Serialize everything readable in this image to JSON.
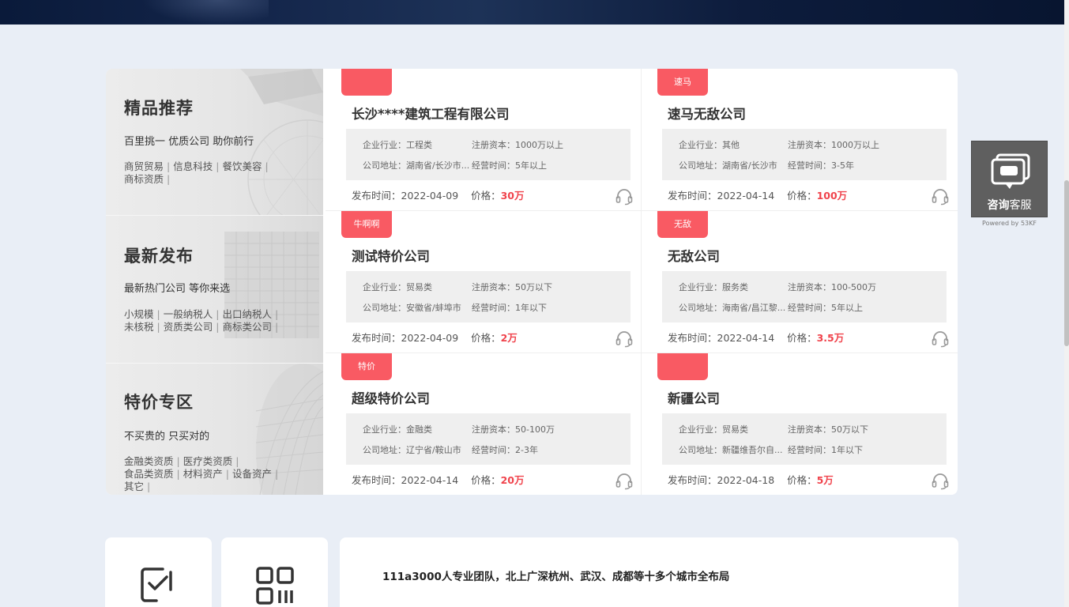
{
  "left_categories": [
    {
      "title": "精品推荐",
      "subtitle": "百里挑一 优质公司 助你前行",
      "tags": [
        "商贸贸易",
        "信息科技",
        "餐饮美容",
        "商标资质"
      ]
    },
    {
      "title": "最新发布",
      "subtitle": "最新热门公司 等你来选",
      "tags": [
        "小规模",
        "一般纳税人",
        "出口纳税人",
        "未核税",
        "资质类公司",
        "商标类公司"
      ]
    },
    {
      "title": "特价专区",
      "subtitle": "不买贵的 只买对的",
      "tags": [
        "金融类资质",
        "医疗类资质",
        "食品类资质",
        "材料资产",
        "设备资产",
        "其它"
      ]
    }
  ],
  "labels": {
    "industry": "企业行业：",
    "capital": "注册资本：",
    "address": "公司地址：",
    "years": "经营时间：",
    "publish": "发布时间：",
    "price": "价格："
  },
  "companies": [
    {
      "badge": "",
      "name": "长沙****建筑工程有限公司",
      "industry": "工程类",
      "capital": "1000万以上",
      "address": "湖南省/长沙市...",
      "years": "5年以上",
      "date": "2022-04-09",
      "price": "30万"
    },
    {
      "badge": "速马",
      "name": "速马无敌公司",
      "industry": "其他",
      "capital": "1000万以上",
      "address": "湖南省/长沙市",
      "years": "3-5年",
      "date": "2022-04-14",
      "price": "100万"
    },
    {
      "badge": "牛啊啊",
      "name": "测试特价公司",
      "industry": "贸易类",
      "capital": "50万以下",
      "address": "安徽省/蚌埠市",
      "years": "1年以下",
      "date": "2022-04-09",
      "price": "2万"
    },
    {
      "badge": "无敌",
      "name": "无敌公司",
      "industry": "服务类",
      "capital": "100-500万",
      "address": "海南省/昌江黎...",
      "years": "5年以上",
      "date": "2022-04-14",
      "price": "3.5万"
    },
    {
      "badge": "特价",
      "name": "超级特价公司",
      "industry": "金融类",
      "capital": "50-100万",
      "address": "辽宁省/鞍山市",
      "years": "2-3年",
      "date": "2022-04-14",
      "price": "20万"
    },
    {
      "badge": "",
      "name": "新疆公司",
      "industry": "贸易类",
      "capital": "50万以下",
      "address": "新疆维吾尔自...",
      "years": "1年以下",
      "date": "2022-04-18",
      "price": "5万"
    }
  ],
  "float_service": {
    "label_bold": "咨询",
    "label_rest": "客服",
    "powered": "Powered by 53KF"
  },
  "bottom": {
    "headline": "111a3000人专业团队，北上广深杭州、武汉、成都等十多个城市全布局"
  },
  "colors": {
    "accent": "#f95a63",
    "price": "#f0434c",
    "page_bg": "#e9eef6"
  },
  "icons": {
    "headset": "headset-icon",
    "chat": "chat-bubble-icon",
    "check_doc": "checklist-icon",
    "qr": "qr-code-icon"
  }
}
